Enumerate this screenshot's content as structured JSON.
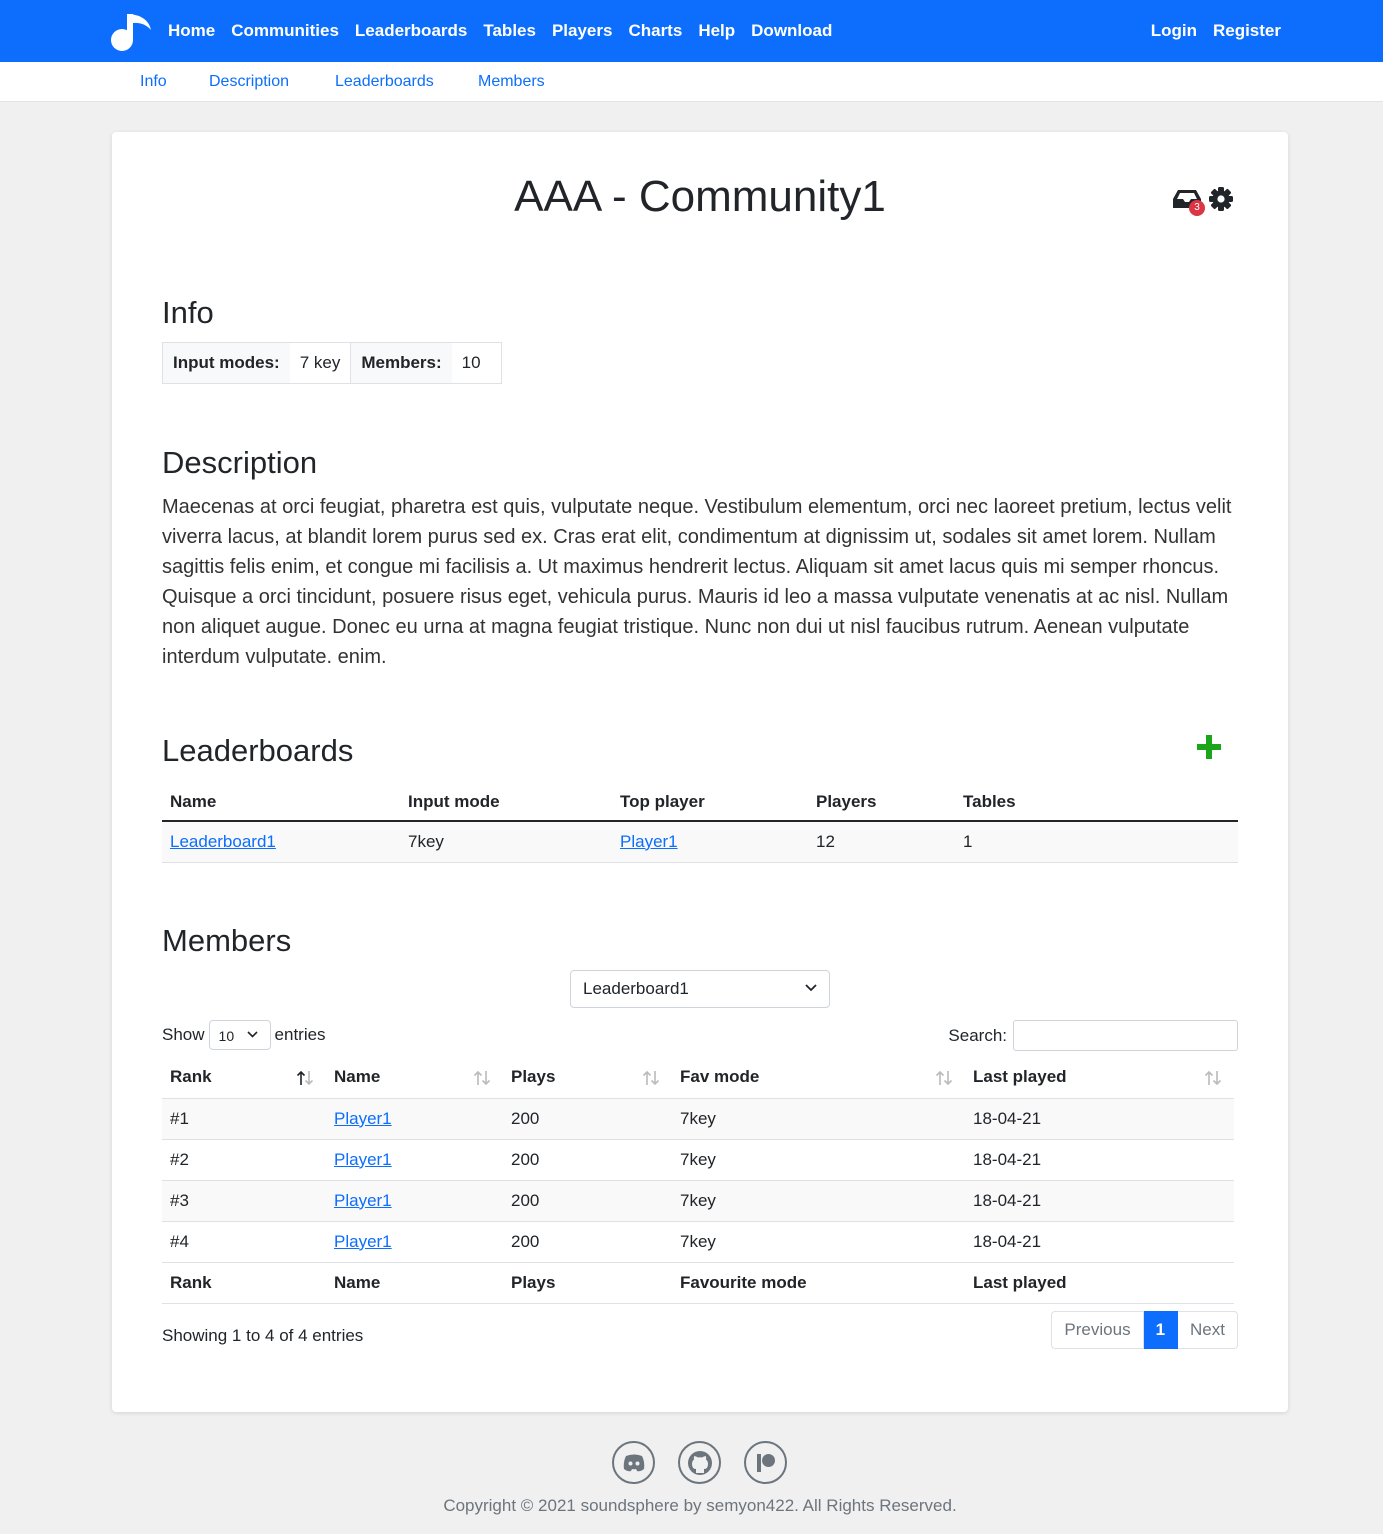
{
  "navbar": {
    "links": [
      "Home",
      "Communities",
      "Leaderboards",
      "Tables",
      "Players",
      "Charts",
      "Help",
      "Download"
    ],
    "login": "Login",
    "register": "Register"
  },
  "subnav": [
    "Info",
    "Description",
    "Leaderboards",
    "Members"
  ],
  "page": {
    "title": "AAA - Community1",
    "inbox_count": "3"
  },
  "info": {
    "heading": "Info",
    "input_modes_label": "Input modes:",
    "input_modes_value": "7 key",
    "members_label": "Members:",
    "members_value": "10"
  },
  "description": {
    "heading": "Description",
    "text": "Maecenas at orci feugiat, pharetra est quis, vulputate neque. Vestibulum elementum, orci nec laoreet pretium, lectus velit viverra lacus, at blandit lorem purus sed ex. Cras erat elit, condimentum at dignissim ut, sodales sit amet lorem. Nullam sagittis felis enim, et congue mi facilisis a. Ut maximus hendrerit lectus. Aliquam sit amet lacus quis mi semper rhoncus. Quisque a orci tincidunt, posuere risus eget, vehicula purus. Mauris id leo a massa vulputate venenatis at ac nisl. Nullam non aliquet augue. Donec eu urna at magna feugiat tristique. Nunc non dui ut nisl faucibus rutrum. Aenean vulputate interdum vulputate. enim."
  },
  "leaderboards": {
    "heading": "Leaderboards",
    "columns": [
      "Name",
      "Input mode",
      "Top player",
      "Players",
      "Tables"
    ],
    "rows": [
      {
        "name": "Leaderboard1",
        "input_mode": "7key",
        "top_player": "Player1",
        "players": "12",
        "tables": "1"
      }
    ]
  },
  "members": {
    "heading": "Members",
    "leaderboard_select": "Leaderboard1",
    "show_label": "Show",
    "page_length": "10",
    "entries_label": "entries",
    "search_label": "Search:",
    "search_value": "",
    "columns": [
      "Rank",
      "Name",
      "Plays",
      "Fav mode",
      "Last played"
    ],
    "footer_columns": [
      "Rank",
      "Name",
      "Plays",
      "Favourite mode",
      "Last played"
    ],
    "rows": [
      {
        "rank": "#1",
        "name": "Player1",
        "plays": "200",
        "fav_mode": "7key",
        "last_played": "18-04-21"
      },
      {
        "rank": "#2",
        "name": "Player1",
        "plays": "200",
        "fav_mode": "7key",
        "last_played": "18-04-21"
      },
      {
        "rank": "#3",
        "name": "Player1",
        "plays": "200",
        "fav_mode": "7key",
        "last_played": "18-04-21"
      },
      {
        "rank": "#4",
        "name": "Player1",
        "plays": "200",
        "fav_mode": "7key",
        "last_played": "18-04-21"
      }
    ],
    "info_text": "Showing 1 to 4 of 4 entries",
    "pager": {
      "previous": "Previous",
      "current": "1",
      "next": "Next"
    }
  },
  "footer": {
    "icons": [
      "discord-icon",
      "github-icon",
      "patreon-icon"
    ],
    "copyright": "Copyright © 2021 soundsphere by semyon422. All Rights Reserved."
  },
  "colors": {
    "primary": "#0d6efd",
    "add": "#1aa51a",
    "badge": "#dc3545"
  }
}
